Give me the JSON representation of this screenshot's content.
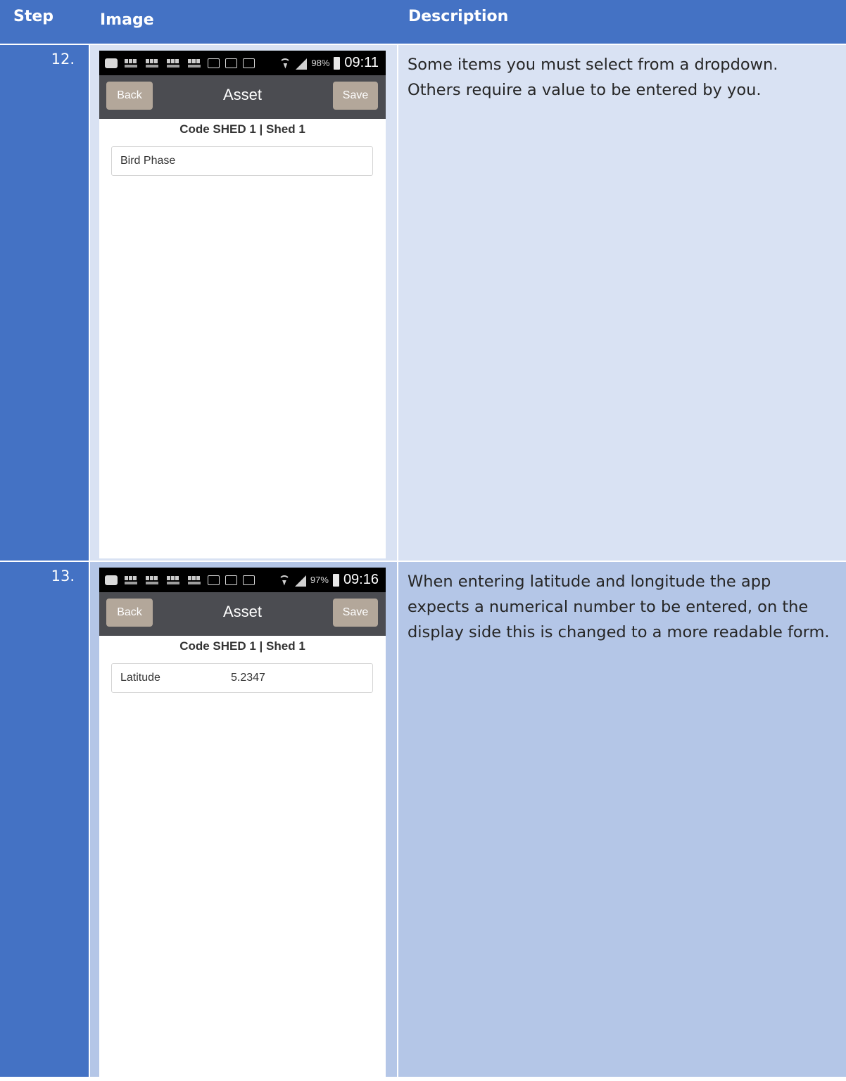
{
  "header": {
    "step": "Step",
    "image": "Image",
    "description": "Description"
  },
  "rows": [
    {
      "step": "12.",
      "phone": {
        "battery": "98%",
        "time": "09:11",
        "back_label": "Back",
        "title": "Asset",
        "save_label": "Save",
        "subtitle": "Code SHED 1 | Shed 1",
        "field_label": "Bird Phase",
        "field_value": ""
      },
      "description": "Some items you must select from a dropdown. Others require a value to be entered by you."
    },
    {
      "step": "13.",
      "phone": {
        "battery": "97%",
        "time": "09:16",
        "back_label": "Back",
        "title": "Asset",
        "save_label": "Save",
        "subtitle": "Code SHED 1 | Shed 1",
        "field_label": "Latitude",
        "field_value": "5.2347"
      },
      "description": "When entering latitude and longitude the app expects a numerical number to be entered, on the display side this is changed to a more readable form."
    }
  ],
  "colors": {
    "header_blue": "#4472c4",
    "row_light": "#d9e2f3",
    "row_mid": "#b4c6e7",
    "nav_dark": "#4b4c51",
    "button_tan": "#b3a79a"
  }
}
